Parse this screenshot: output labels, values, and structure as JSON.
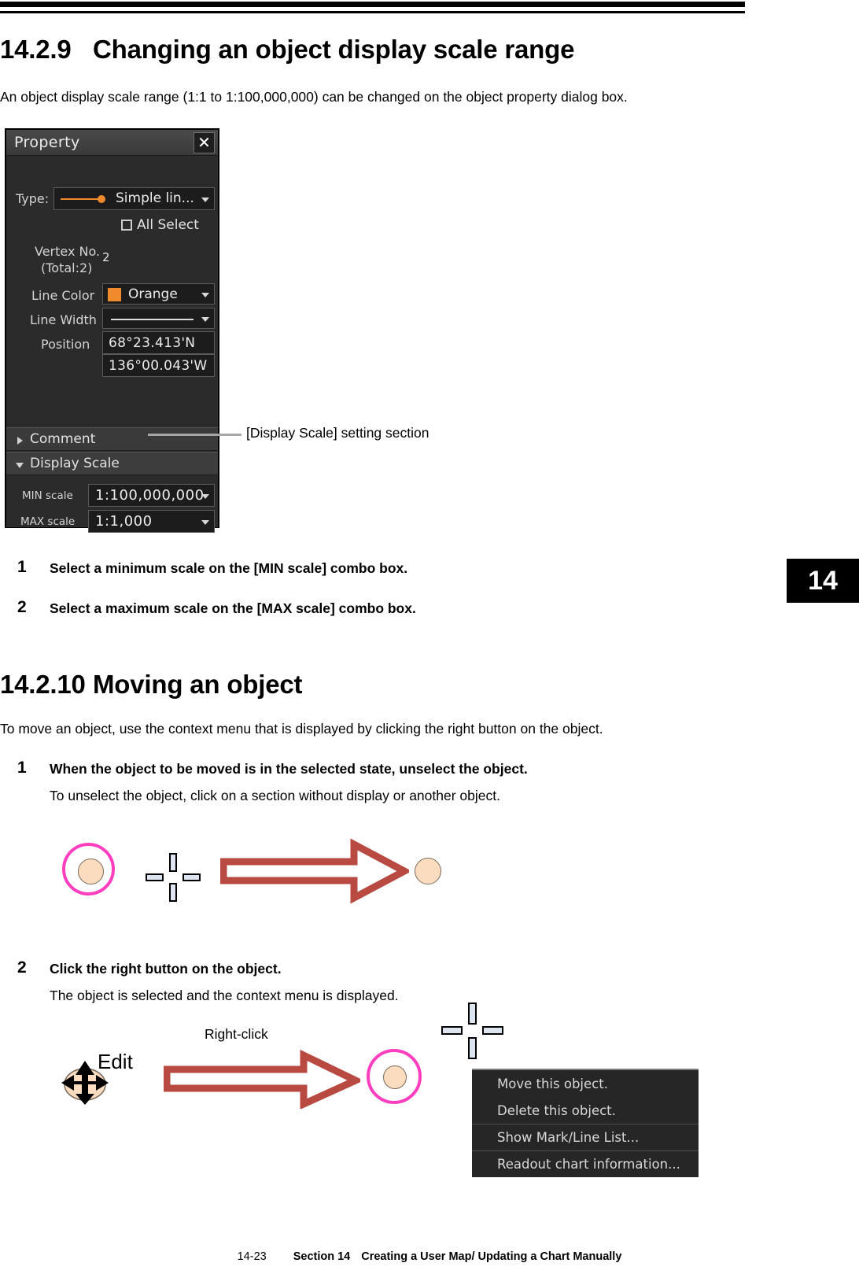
{
  "page": {
    "heading1_number": "14.2.9",
    "heading1_title": "Changing an object display scale range",
    "intro1": "An object display scale range (1:1 to 1:100,000,000) can be changed on the object property dialog box.",
    "heading2_number": "14.2.10",
    "heading2_title": "Moving an object",
    "intro2": "To move an object, use the context menu that is displayed by clicking the right button on the object.",
    "chapter_tab": "14"
  },
  "callout": {
    "text": "[Display Scale] setting section"
  },
  "steps_a": [
    {
      "num": "1",
      "title": "Select a minimum scale on the [MIN scale] combo box."
    },
    {
      "num": "2",
      "title": "Select a maximum scale on the [MAX scale] combo box."
    }
  ],
  "steps_b": [
    {
      "num": "1",
      "title": "When the object to be moved is in the selected state, unselect the object.",
      "sub": "To unselect the object, click on a section without display or another object."
    },
    {
      "num": "2",
      "title": "Click the right button on the object.",
      "sub": "The object is selected and the context menu is displayed."
    }
  ],
  "property_dialog": {
    "title": "Property",
    "close_label": "✕",
    "type_label": "Type:",
    "type_value": "Simple lin...",
    "all_select_label": "All Select",
    "vertex_label_line1": "Vertex No.",
    "vertex_label_line2": "(Total:2)",
    "vertex_value": "2",
    "line_color_label": "Line Color",
    "line_color_value": "Orange",
    "line_color_hex": "#ef8b2c",
    "line_width_label": "Line Width",
    "position_label": "Position",
    "position_lat": "68°23.413'N",
    "position_lon": "136°00.043'W",
    "comment_section": "Comment",
    "display_scale_section": "Display Scale",
    "min_scale_label": "MIN scale",
    "min_scale_value": "1:100,000,000",
    "max_scale_label": "MAX scale",
    "max_scale_value": "1:1,000"
  },
  "figure2": {
    "edit_label": "Edit",
    "right_click_label": "Right-click"
  },
  "context_menu": {
    "items": [
      {
        "label": "Move this object."
      },
      {
        "label": "Delete this object."
      },
      {
        "label": "Show Mark/Line List..."
      },
      {
        "label": "Readout chart information..."
      }
    ]
  },
  "footer": {
    "page_number": "14-23",
    "section": "Section 14",
    "section_title": "Creating a User Map/ Updating a Chart Manually"
  }
}
